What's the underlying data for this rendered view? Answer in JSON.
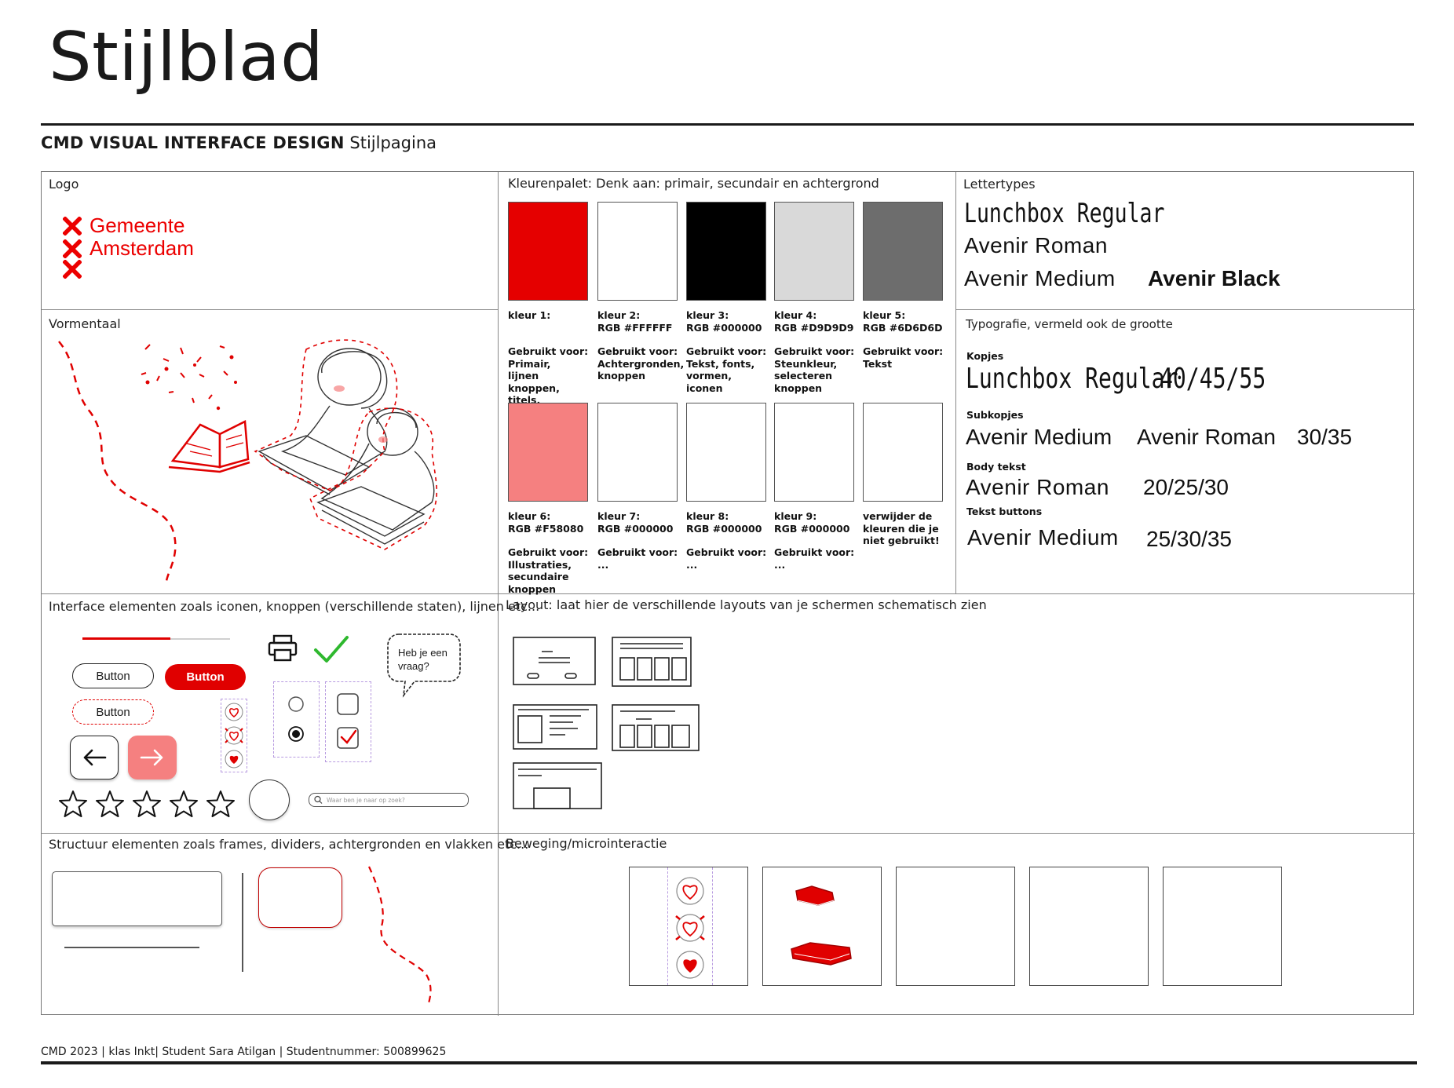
{
  "header": {
    "title": "Stijlblad",
    "subtitle_bold": "CMD VISUAL INTERFACE DESIGN",
    "subtitle_rest": "Stijlpagina"
  },
  "logo": {
    "label": "Logo",
    "line1": "Gemeente",
    "line2": "Amsterdam",
    "color": "#ec0000"
  },
  "palette": {
    "label": "Kleurenpalet: Denk aan: primair, secundair en achtergrond",
    "row1": [
      {
        "color": "#E50000",
        "name": "kleur 1:",
        "rgb": "",
        "use_title": "Gebruikt voor:",
        "use": "Primair,\nlijnen knoppen,\ntitels, illustraties"
      },
      {
        "color": "#FFFFFF",
        "name": "kleur 2:",
        "rgb": "RGB #FFFFFF",
        "use_title": "Gebruikt voor:",
        "use": "Achtergronden,\nknoppen"
      },
      {
        "color": "#000000",
        "name": "kleur 3:",
        "rgb": "RGB #000000",
        "use_title": "Gebruikt voor:",
        "use": "Tekst, fonts,\nvormen, iconen"
      },
      {
        "color": "#D9D9D9",
        "name": "kleur 4:",
        "rgb": "RGB #D9D9D9",
        "use_title": "Gebruikt voor:",
        "use": "Steunkleur,\nselecteren\nknoppen"
      },
      {
        "color": "#6D6D6D",
        "name": "kleur 5:",
        "rgb": "RGB #6D6D6D",
        "use_title": "Gebruikt voor:",
        "use": "Tekst"
      }
    ],
    "row2": [
      {
        "color": "#F58080",
        "name": "kleur 6:",
        "rgb": "RGB #F58080",
        "use_title": "Gebruikt voor:",
        "use": "Illustraties,\nsecundaire\nknoppen"
      },
      {
        "color": "#FFFFFF",
        "name": "kleur 7:",
        "rgb": "RGB #000000",
        "use_title": "Gebruikt voor:",
        "use": "..."
      },
      {
        "color": "#FFFFFF",
        "name": "kleur 8:",
        "rgb": "RGB #000000",
        "use_title": "Gebruikt voor:",
        "use": "..."
      },
      {
        "color": "#FFFFFF",
        "name": "kleur 9:",
        "rgb": "RGB #000000",
        "use_title": "Gebruikt voor:",
        "use": "..."
      },
      {
        "color": "#FFFFFF",
        "name": "verwijder de\nkleuren die je\nniet gebruikt!",
        "rgb": "",
        "use_title": "",
        "use": ""
      }
    ]
  },
  "fonts": {
    "label": "Lettertypes",
    "f1": "Lunchbox Regular",
    "f2": "Avenir Roman",
    "f3": "Avenir Medium",
    "f4": "Avenir Black"
  },
  "typography": {
    "label": "Typografie, vermeld ook de grootte",
    "kopjes_label": "Kopjes",
    "kopjes_font": "Lunchbox Regular",
    "kopjes_size": "40/45/55",
    "sub_label": "Subkopjes",
    "sub_font1": "Avenir Medium",
    "sub_font2": "Avenir Roman",
    "sub_size": "30/35",
    "body_label": "Body tekst",
    "body_font": "Avenir Roman",
    "body_size": "20/25/30",
    "btn_label": "Tekst buttons",
    "btn_font": "Avenir Medium",
    "btn_size": "25/30/35"
  },
  "vormentaal": {
    "label": "Vormentaal"
  },
  "interface": {
    "label": "Interface elementen zoals iconen, knoppen (verschillende staten), lijnen etc...",
    "button1": "Button",
    "button2": "Button",
    "button3": "Button",
    "bubble": "Heb je een\nvraag?",
    "search_placeholder": "Waar ben je naar op zoek?",
    "stars_filled": 0,
    "stars_total": 5
  },
  "layout": {
    "label": "Layout: laat hier de verschillende layouts van je schermen schematisch zien"
  },
  "structuur": {
    "label": "Structuur elementen zoals frames, dividers, achtergronden en vlakken  etc..."
  },
  "beweging": {
    "label": "Beweging/microinteractie"
  },
  "footer": {
    "text": "CMD 2023 | klas Inkt| Student Sara Atilgan | Studentnummer: 500899625"
  }
}
